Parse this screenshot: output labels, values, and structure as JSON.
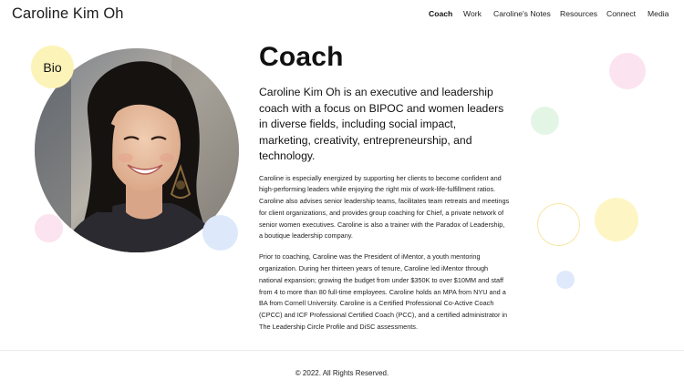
{
  "header": {
    "site_title": "Caroline Kim Oh",
    "nav": [
      {
        "label": "Coach",
        "active": true
      },
      {
        "label": "Work",
        "active": false
      },
      {
        "label": "Caroline's Notes",
        "active": false
      },
      {
        "label": "Resources",
        "active": false
      },
      {
        "label": "Connect",
        "active": false
      },
      {
        "label": "Media",
        "active": false
      }
    ]
  },
  "profile": {
    "badge_label": "Bio",
    "photo_icon": "portrait-photo"
  },
  "main": {
    "title": "Coach",
    "lead": "Caroline Kim Oh is an executive and leadership coach with a focus on BIPOC and women leaders in diverse fields, including social impact, marketing, creativity, entrepreneurship, and technology.",
    "paragraphs": [
      "Caroline is especially energized by supporting her clients to become confident and high-performing leaders while enjoying the right mix of work-life-fulfillment ratios. Caroline also advises senior leadership teams, facilitates team retreats and meetings for client organizations, and provides group coaching for Chief, a private network of senior women executives. Caroline is also a trainer with the Paradox of Leadership, a boutique leadership company.",
      "Prior to coaching, Caroline was the President of iMentor, a youth mentoring organization. During her thirteen years of tenure, Caroline led iMentor through national expansion; growing the budget from under $350K to over $10MM and staff from 4 to more than 80 full-time employees. Caroline holds an MPA from NYU and a BA from Cornell University. Caroline is a Certified Professional Co-Active Coach (CPCC) and ICF Professional Certified Coach (PCC), and a certified administrator in The Leadership Circle Profile and DiSC assessments."
    ]
  },
  "footer": {
    "copyright": "© 2022. All Rights Reserved."
  },
  "colors": {
    "pink": "#fbe3ef",
    "green": "#e3f6e5",
    "yellow": "#fdf6c4",
    "blue": "#dde9fb"
  }
}
